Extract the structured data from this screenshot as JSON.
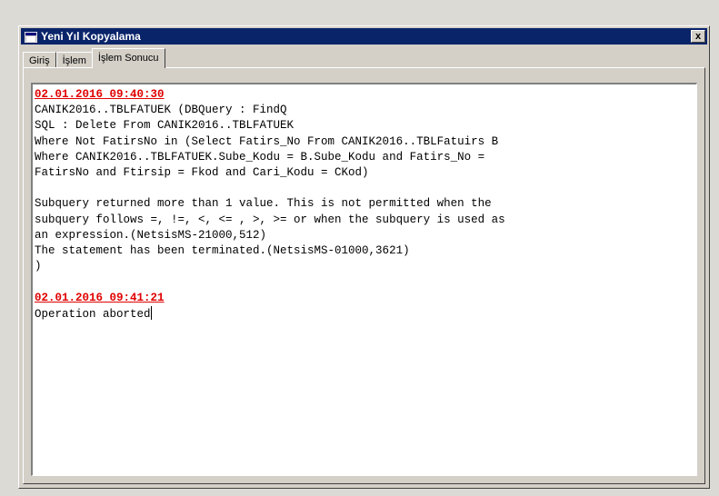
{
  "window": {
    "title": "Yeni Yıl Kopyalama",
    "close_label": "x"
  },
  "tabs": [
    {
      "label": "Giriş"
    },
    {
      "label": "İşlem"
    },
    {
      "label": "İşlem Sonucu",
      "active": true
    }
  ],
  "log": {
    "entries": [
      {
        "timestamp": "02.01.2016 09:40:30",
        "lines": [
          "CANIK2016..TBLFATUEK (DBQuery : FindQ",
          "SQL : Delete From CANIK2016..TBLFATUEK",
          "Where Not FatirsNo in (Select Fatirs_No From CANIK2016..TBLFatuirs B",
          "Where CANIK2016..TBLFATUEK.Sube_Kodu = B.Sube_Kodu and Fatirs_No =",
          "FatirsNo and Ftirsip = Fkod and Cari_Kodu = CKod)",
          "",
          "Subquery returned more than 1 value. This is not permitted when the",
          "subquery follows =, !=, <, <= , >, >= or when the subquery is used as",
          "an expression.(NetsisMS-21000,512)",
          "The statement has been terminated.(NetsisMS-01000,3621)",
          ")"
        ]
      },
      {
        "timestamp": "02.01.2016 09:41:21",
        "lines": [
          "Operation aborted"
        ]
      }
    ]
  },
  "colors": {
    "titlebar": "#0a246a",
    "timestamp": "#e00000",
    "face": "#d4d0c8"
  }
}
